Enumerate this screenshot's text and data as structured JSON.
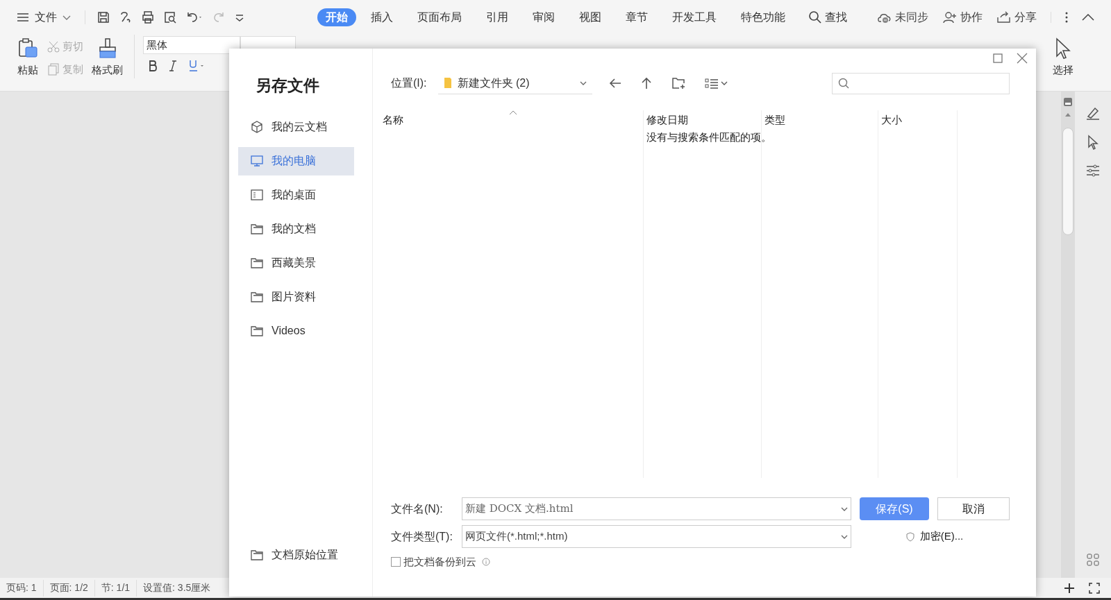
{
  "menu": {
    "label": "文件"
  },
  "tabs": [
    {
      "label": "开始",
      "selected": true
    },
    {
      "label": "插入",
      "selected": false
    },
    {
      "label": "页面布局",
      "selected": false
    },
    {
      "label": "引用",
      "selected": false
    },
    {
      "label": "审阅",
      "selected": false
    },
    {
      "label": "视图",
      "selected": false
    },
    {
      "label": "章节",
      "selected": false
    },
    {
      "label": "开发工具",
      "selected": false
    },
    {
      "label": "特色功能",
      "selected": false
    }
  ],
  "search_tab": "查找",
  "top_actions": [
    {
      "kind": "sync",
      "label": "未同步"
    },
    {
      "kind": "collab",
      "label": "协作"
    },
    {
      "kind": "share",
      "label": "分享"
    }
  ],
  "ribbon": {
    "paste": "粘贴",
    "cut": {
      "label": "剪切",
      "disabled": true
    },
    "copy": {
      "label": "复制",
      "disabled": true
    },
    "format_painter": "格式刷",
    "font": "黑体",
    "select": "选择"
  },
  "dialog": {
    "title": "另存文件",
    "places": [
      {
        "kind": "cloud",
        "label": "我的云文档",
        "selected": false
      },
      {
        "kind": "computer",
        "label": "我的电脑",
        "selected": true
      },
      {
        "kind": "desktop",
        "label": "我的桌面",
        "selected": false
      },
      {
        "kind": "folder",
        "label": "我的文档",
        "selected": false
      },
      {
        "kind": "folder",
        "label": "西藏美景",
        "selected": false
      },
      {
        "kind": "folder",
        "label": "图片资料",
        "selected": false
      },
      {
        "kind": "folder",
        "label": "Videos",
        "selected": false
      }
    ],
    "original_location": "文档原始位置",
    "location": {
      "label": "位置(I):",
      "value": "新建文件夹 (2)"
    },
    "columns": [
      "名称",
      "修改日期",
      "类型",
      "大小"
    ],
    "empty_message": "没有与搜索条件匹配的项。",
    "file_name": {
      "label": "文件名(N):",
      "value": "新建 DOCX 文档.html"
    },
    "file_type": {
      "label": "文件类型(T):",
      "value": "网页文件(*.html;*.htm)"
    },
    "save_button": "保存(S)",
    "cancel_button": "取消",
    "encrypt_button": "加密(E)...",
    "backup": {
      "label": "把文档备份到云",
      "checked": false
    }
  },
  "status_bar": [
    "页码: 1",
    "页面: 1/2",
    "节: 1/1",
    "设置值: 3.5厘米"
  ]
}
